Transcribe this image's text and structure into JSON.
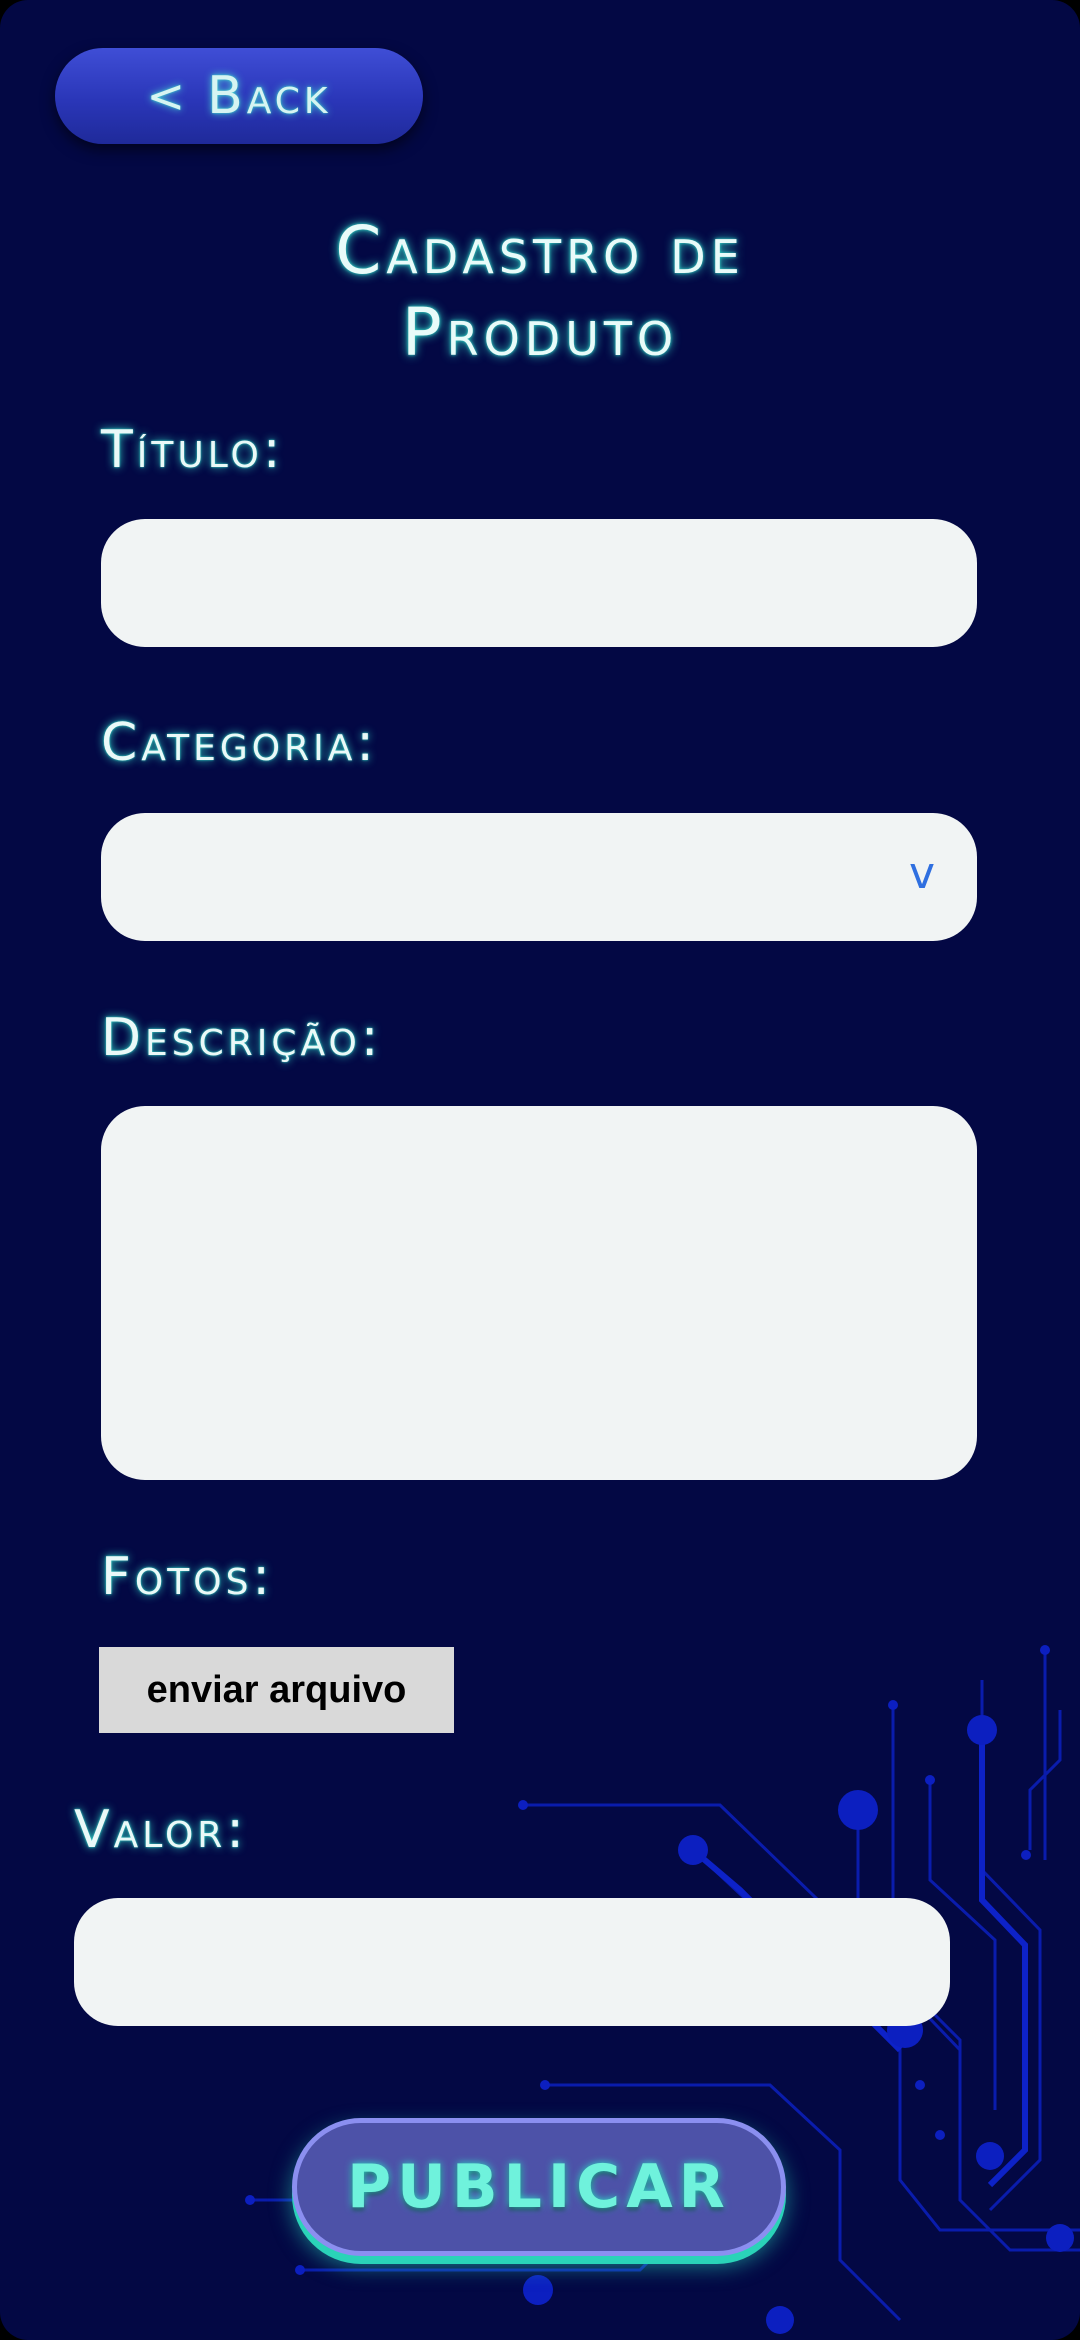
{
  "header": {
    "back_label": "Back"
  },
  "page": {
    "title_line1": "Cadastro de",
    "title_line2": "Produto"
  },
  "form": {
    "titulo_label": "Título:",
    "categoria_label": "Categoria:",
    "categoria_arrow": "v",
    "descricao_label": "Descrição:",
    "fotos_label": "Fotos:",
    "upload_label": "enviar arquivo",
    "valor_label": "Valor:",
    "submit_label": "PUBLICAR"
  },
  "colors": {
    "background": "#030844",
    "accent_glow": "#35e0cf",
    "field_bg": "#f1f4f4",
    "button_blue": "#2a36b8",
    "publish_bg": "#4d52a8"
  }
}
